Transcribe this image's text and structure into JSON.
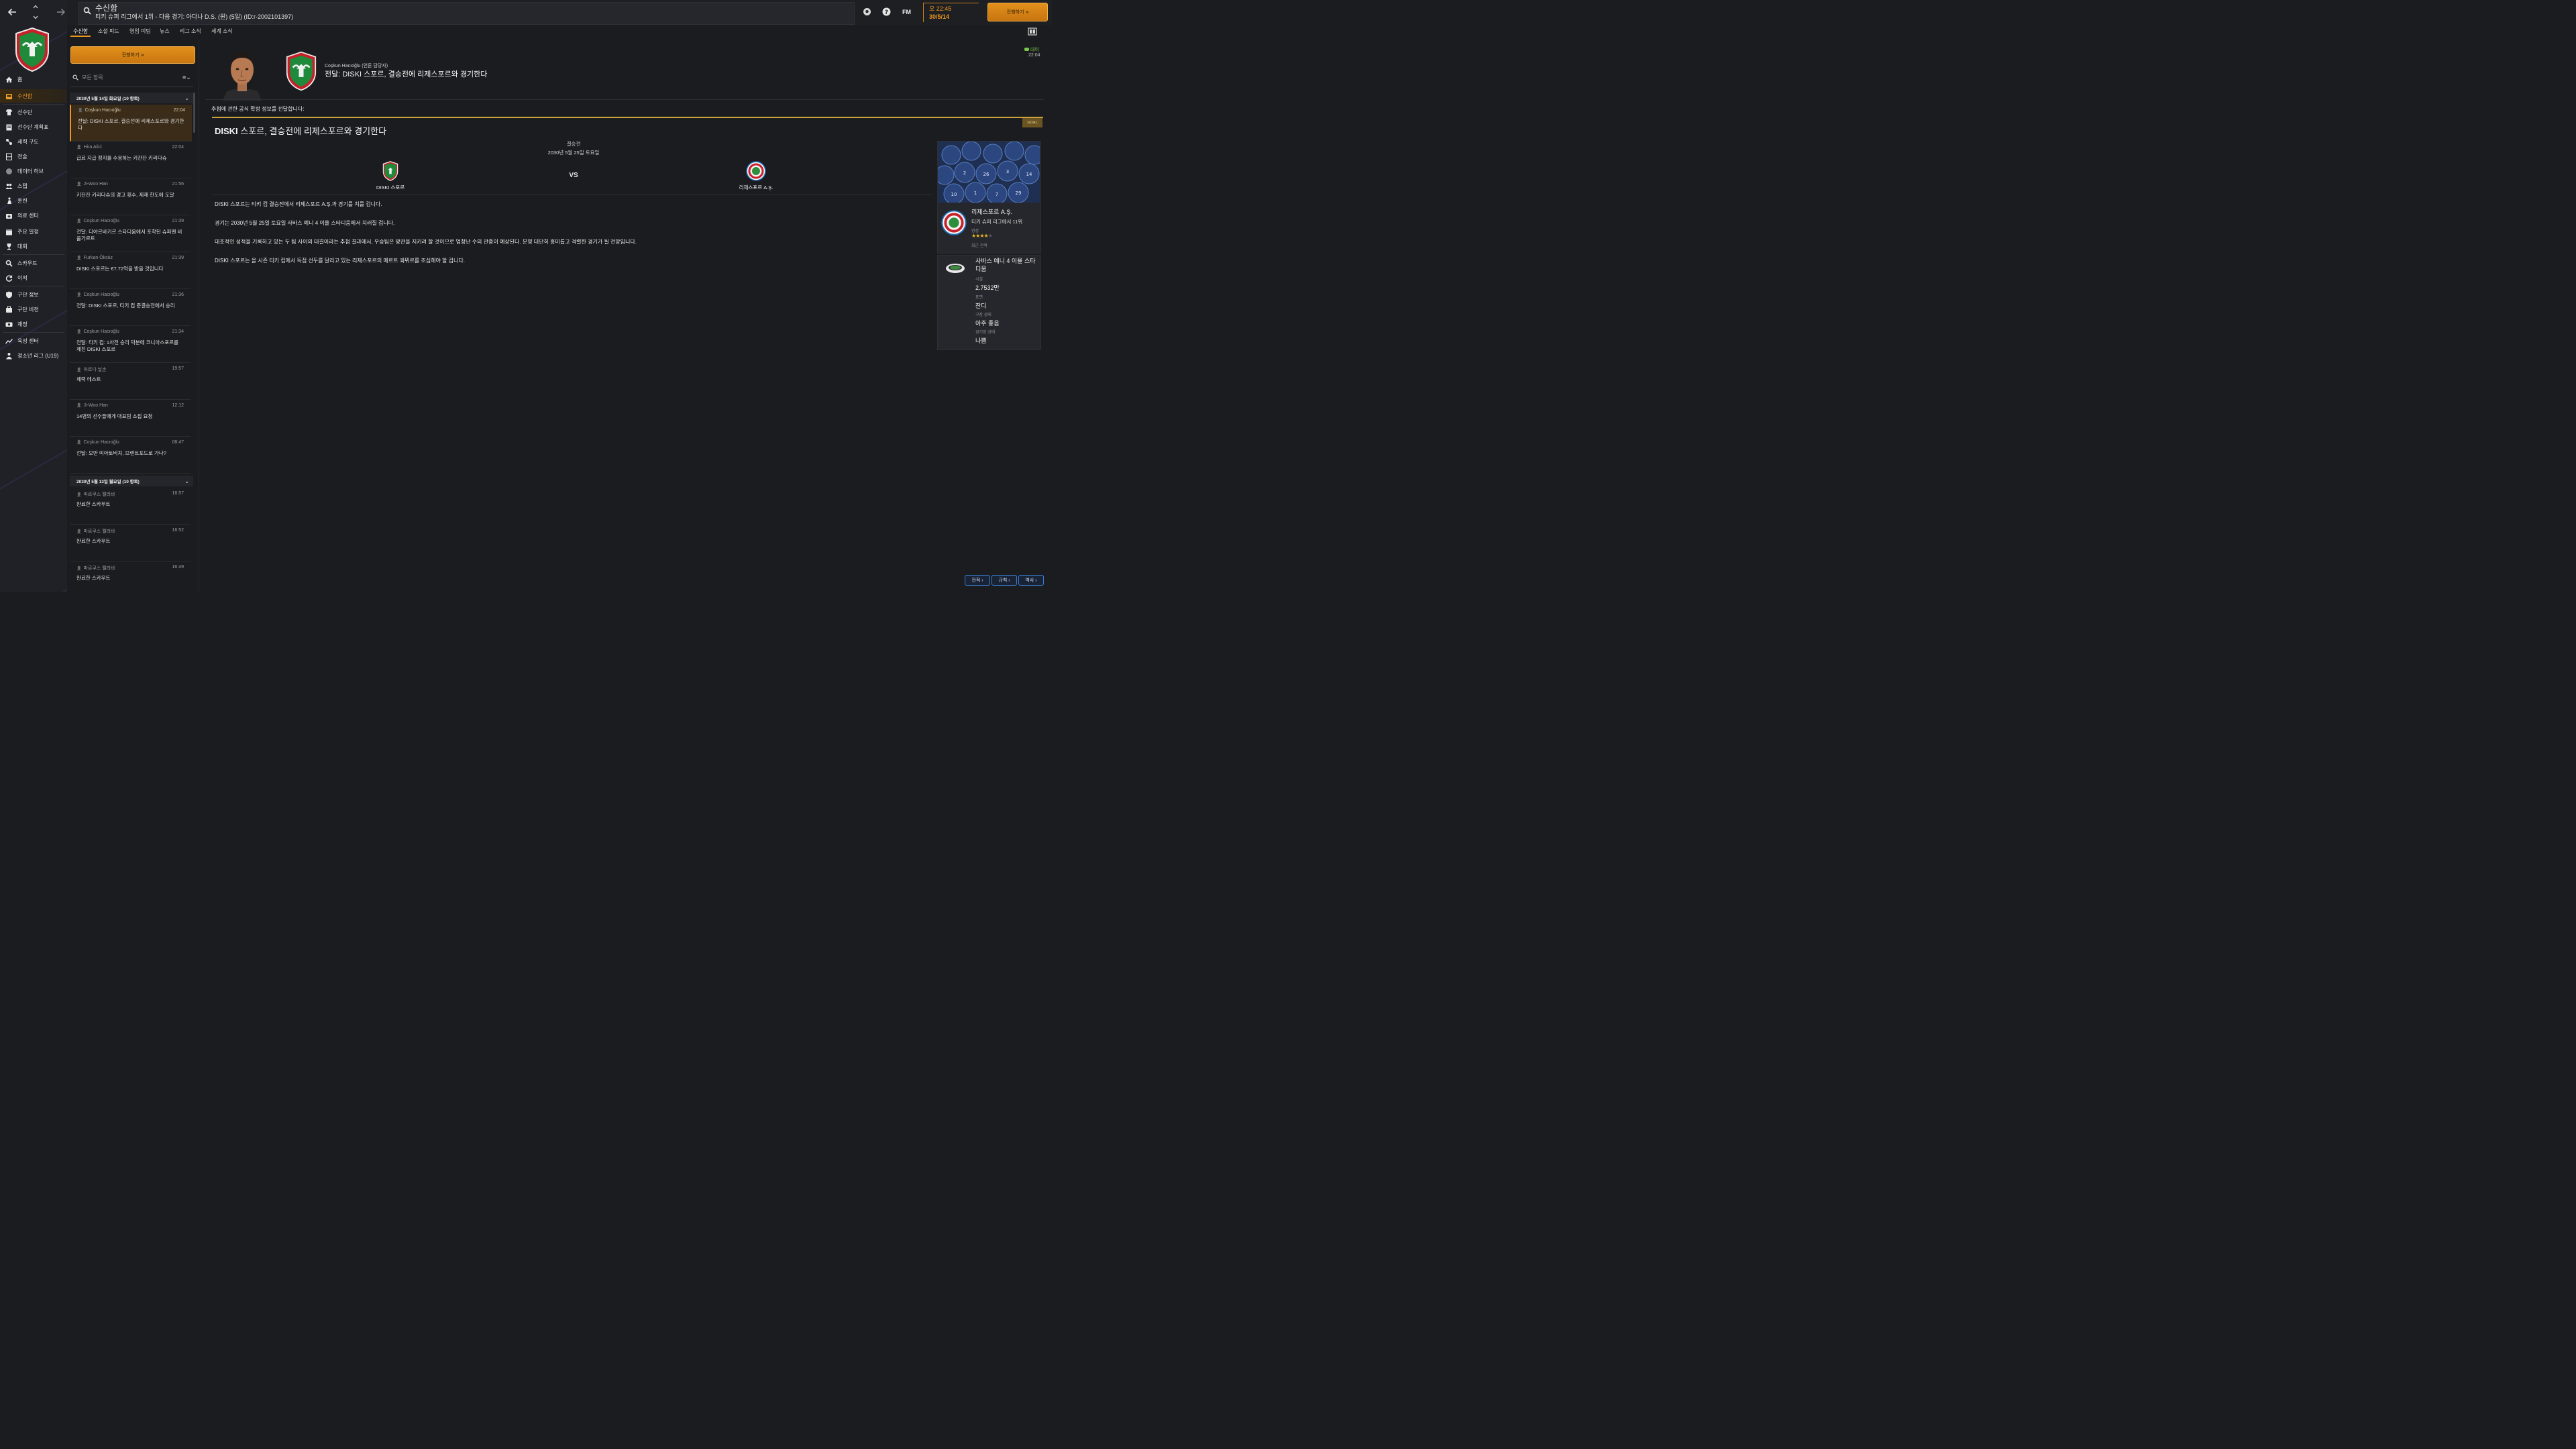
{
  "topbar": {
    "title": "수신함",
    "subtitle": "티키 슈퍼 리그에서 1위 - 다음 경기: 아다나 D.S. (원) (5일) (ID:r-2002101397)",
    "fm_label": "FM",
    "time": "오 22:45",
    "date": "30/5/14",
    "continue_label": "진행하기"
  },
  "tabs": [
    "수신함",
    "소셜 피드",
    "영입 미팅",
    "뉴스",
    "리그 소식",
    "세계 소식"
  ],
  "sidebar": {
    "items": [
      {
        "label": "홈",
        "icon": "home-icon"
      },
      {
        "label": "수신함",
        "icon": "inbox-icon",
        "active": true
      },
      {
        "label": "선수단",
        "icon": "shirt-icon"
      },
      {
        "label": "선수단 계획표",
        "icon": "clipboard-icon"
      },
      {
        "label": "세력 구도",
        "icon": "dynamics-icon"
      },
      {
        "label": "전술",
        "icon": "tactics-icon"
      },
      {
        "label": "데이터 허브",
        "icon": "data-hub-icon"
      },
      {
        "label": "스텝",
        "icon": "staff-icon"
      },
      {
        "label": "훈련",
        "icon": "training-icon"
      },
      {
        "label": "의료 센터",
        "icon": "medical-icon"
      },
      {
        "label": "주요 일정",
        "icon": "calendar-icon"
      },
      {
        "label": "대회",
        "icon": "trophy-icon"
      },
      {
        "label": "스카우트",
        "icon": "scout-icon"
      },
      {
        "label": "이적",
        "icon": "transfer-icon"
      },
      {
        "label": "구단 정보",
        "icon": "shield-icon"
      },
      {
        "label": "구단 비전",
        "icon": "vision-icon"
      },
      {
        "label": "재정",
        "icon": "finance-icon"
      },
      {
        "label": "육성 센터",
        "icon": "development-icon"
      },
      {
        "label": "청소년 리그 (U19)",
        "icon": "youth-icon"
      }
    ]
  },
  "list": {
    "continue_label": "진행하기",
    "filter_placeholder": "모든 항목",
    "groups": [
      {
        "header": "2030년 5월 14일 화요일 (10 항목)",
        "messages": [
          {
            "sender": "Coşkun Hacıoğlu",
            "time": "22:04",
            "subject": "전달: DISKI 스포르, 결승전에 리제스포르와 경기한다",
            "selected": true
          },
          {
            "sender": "Hira Alici",
            "time": "22:04",
            "subject": "급료 지급 정지를 수용하는 키잔잔 키리다슈"
          },
          {
            "sender": "Ji-Woo Han",
            "time": "21:56",
            "subject": "키잔잔 키리다슈의 경고 횟수, 제재 한도에 도달"
          },
          {
            "sender": "Coşkun Hacıoğlu",
            "time": "21:39",
            "subject": "전달: 디야르바키르 스타디움에서 포착된 슈퍼팬 비울가르트"
          },
          {
            "sender": "Furkan Öksüz",
            "time": "21:39",
            "subject": "DISKI 스포르는 €7.72억을 받을 것입니다"
          },
          {
            "sender": "Coşkun Hacıoğlu",
            "time": "21:36",
            "subject": "전달: DISKI 스포르, 티키 컵 준결승전에서 승리"
          },
          {
            "sender": "Coşkun Hacıoğlu",
            "time": "21:34",
            "subject": "전달: 티키 컵: 1차전 승리 덕분에 코니아스포르를 제친 DISKI 스포르"
          },
          {
            "sender": "아르다 날손",
            "time": "19:57",
            "subject": "체력 테스트"
          },
          {
            "sender": "Ji-Woo Han",
            "time": "12:12",
            "subject": "14명의 선수들에게 대표팀 소집 요청"
          },
          {
            "sender": "Coşkun Hacıoğlu",
            "time": "08:47",
            "subject": "전달: 오반 미아토비치, 브렌트포드로 가나?"
          }
        ]
      },
      {
        "header": "2030년 5월 13일 월요일 (10 항목)",
        "messages": [
          {
            "sender": "마르쿠스 펠라바",
            "time": "16:57",
            "subject": "완료한 스카우트"
          },
          {
            "sender": "마르쿠스 펠라바",
            "time": "16:52",
            "subject": "완료한 스카우트"
          },
          {
            "sender": "마르쿠스 펠라바",
            "time": "16:49",
            "subject": "완료한 스카우트"
          }
        ]
      }
    ]
  },
  "detail": {
    "sender_line": "Coşkun Hacıoğlu (언론 담당자)",
    "subject": "전달: DISKI 스포르, 결승전에 리제스포르와 경기한다",
    "reply_label": "대이",
    "time": "22:04",
    "intro": "추첨에 관한 공식 확정 정보를 전달합니다:",
    "goal_badge": "GOAL",
    "headline_bold": "DISKI",
    "headline_rest": " 스포르, 결승전에 리제스포르와 경기한다",
    "match": {
      "stage": "결승전",
      "date": "2030년 5월 25일 토요일",
      "home": "DISKI 스포르",
      "vs": "VS",
      "away": "리제스포르 A.Ş."
    },
    "paragraphs": [
      "DISKI 스포르는 티키 컵 결승전에서 리제스포르 A.Ş.과 경기를 치를 겁니다.",
      "경기는 2030년 5월 25일 토요일 사바스 예니 4 이욜 스타디움에서 치러질 겁니다.",
      "대조적인 성적을 기록하고 있는 두 팀 사이의 대결이라는 추첨 결과에서, 우승팀은 왕관을 지키려 할 것이므로 엄청난 수의 관중이 예상된다. 분명 대단히 흥미롭고 격렬한 경기가 될 전망입니다.",
      "DISKI 스포르는 올 시즌 티키 컵에서 득점 선두를 달리고 있는 리제스포르의 메르트 쾨뮈르를 조심해야 할 겁니다."
    ],
    "opponent_card": {
      "name": "리제스포르 A.Ş.",
      "league": "티키 슈퍼 리그에서 11위",
      "rep_label": "명성",
      "rating": 3.5,
      "form_label": "최근 전적"
    },
    "stadium_card": {
      "name": "사바스 예니 4 이욜 스타디움",
      "capacity_label": "시설",
      "capacity": "2.7532만",
      "surface_label": "표면",
      "surface": "잔디",
      "pitch_label": "구장 상태",
      "pitch": "아주 좋음",
      "weather_label": "경기장 상태",
      "weather": "나쁨"
    },
    "footer_buttons": [
      "전적",
      "규칙",
      "역사"
    ]
  },
  "colors": {
    "accent": "#e8961e",
    "background": "#1b1c1f",
    "gold_line": "#c9a23a"
  }
}
